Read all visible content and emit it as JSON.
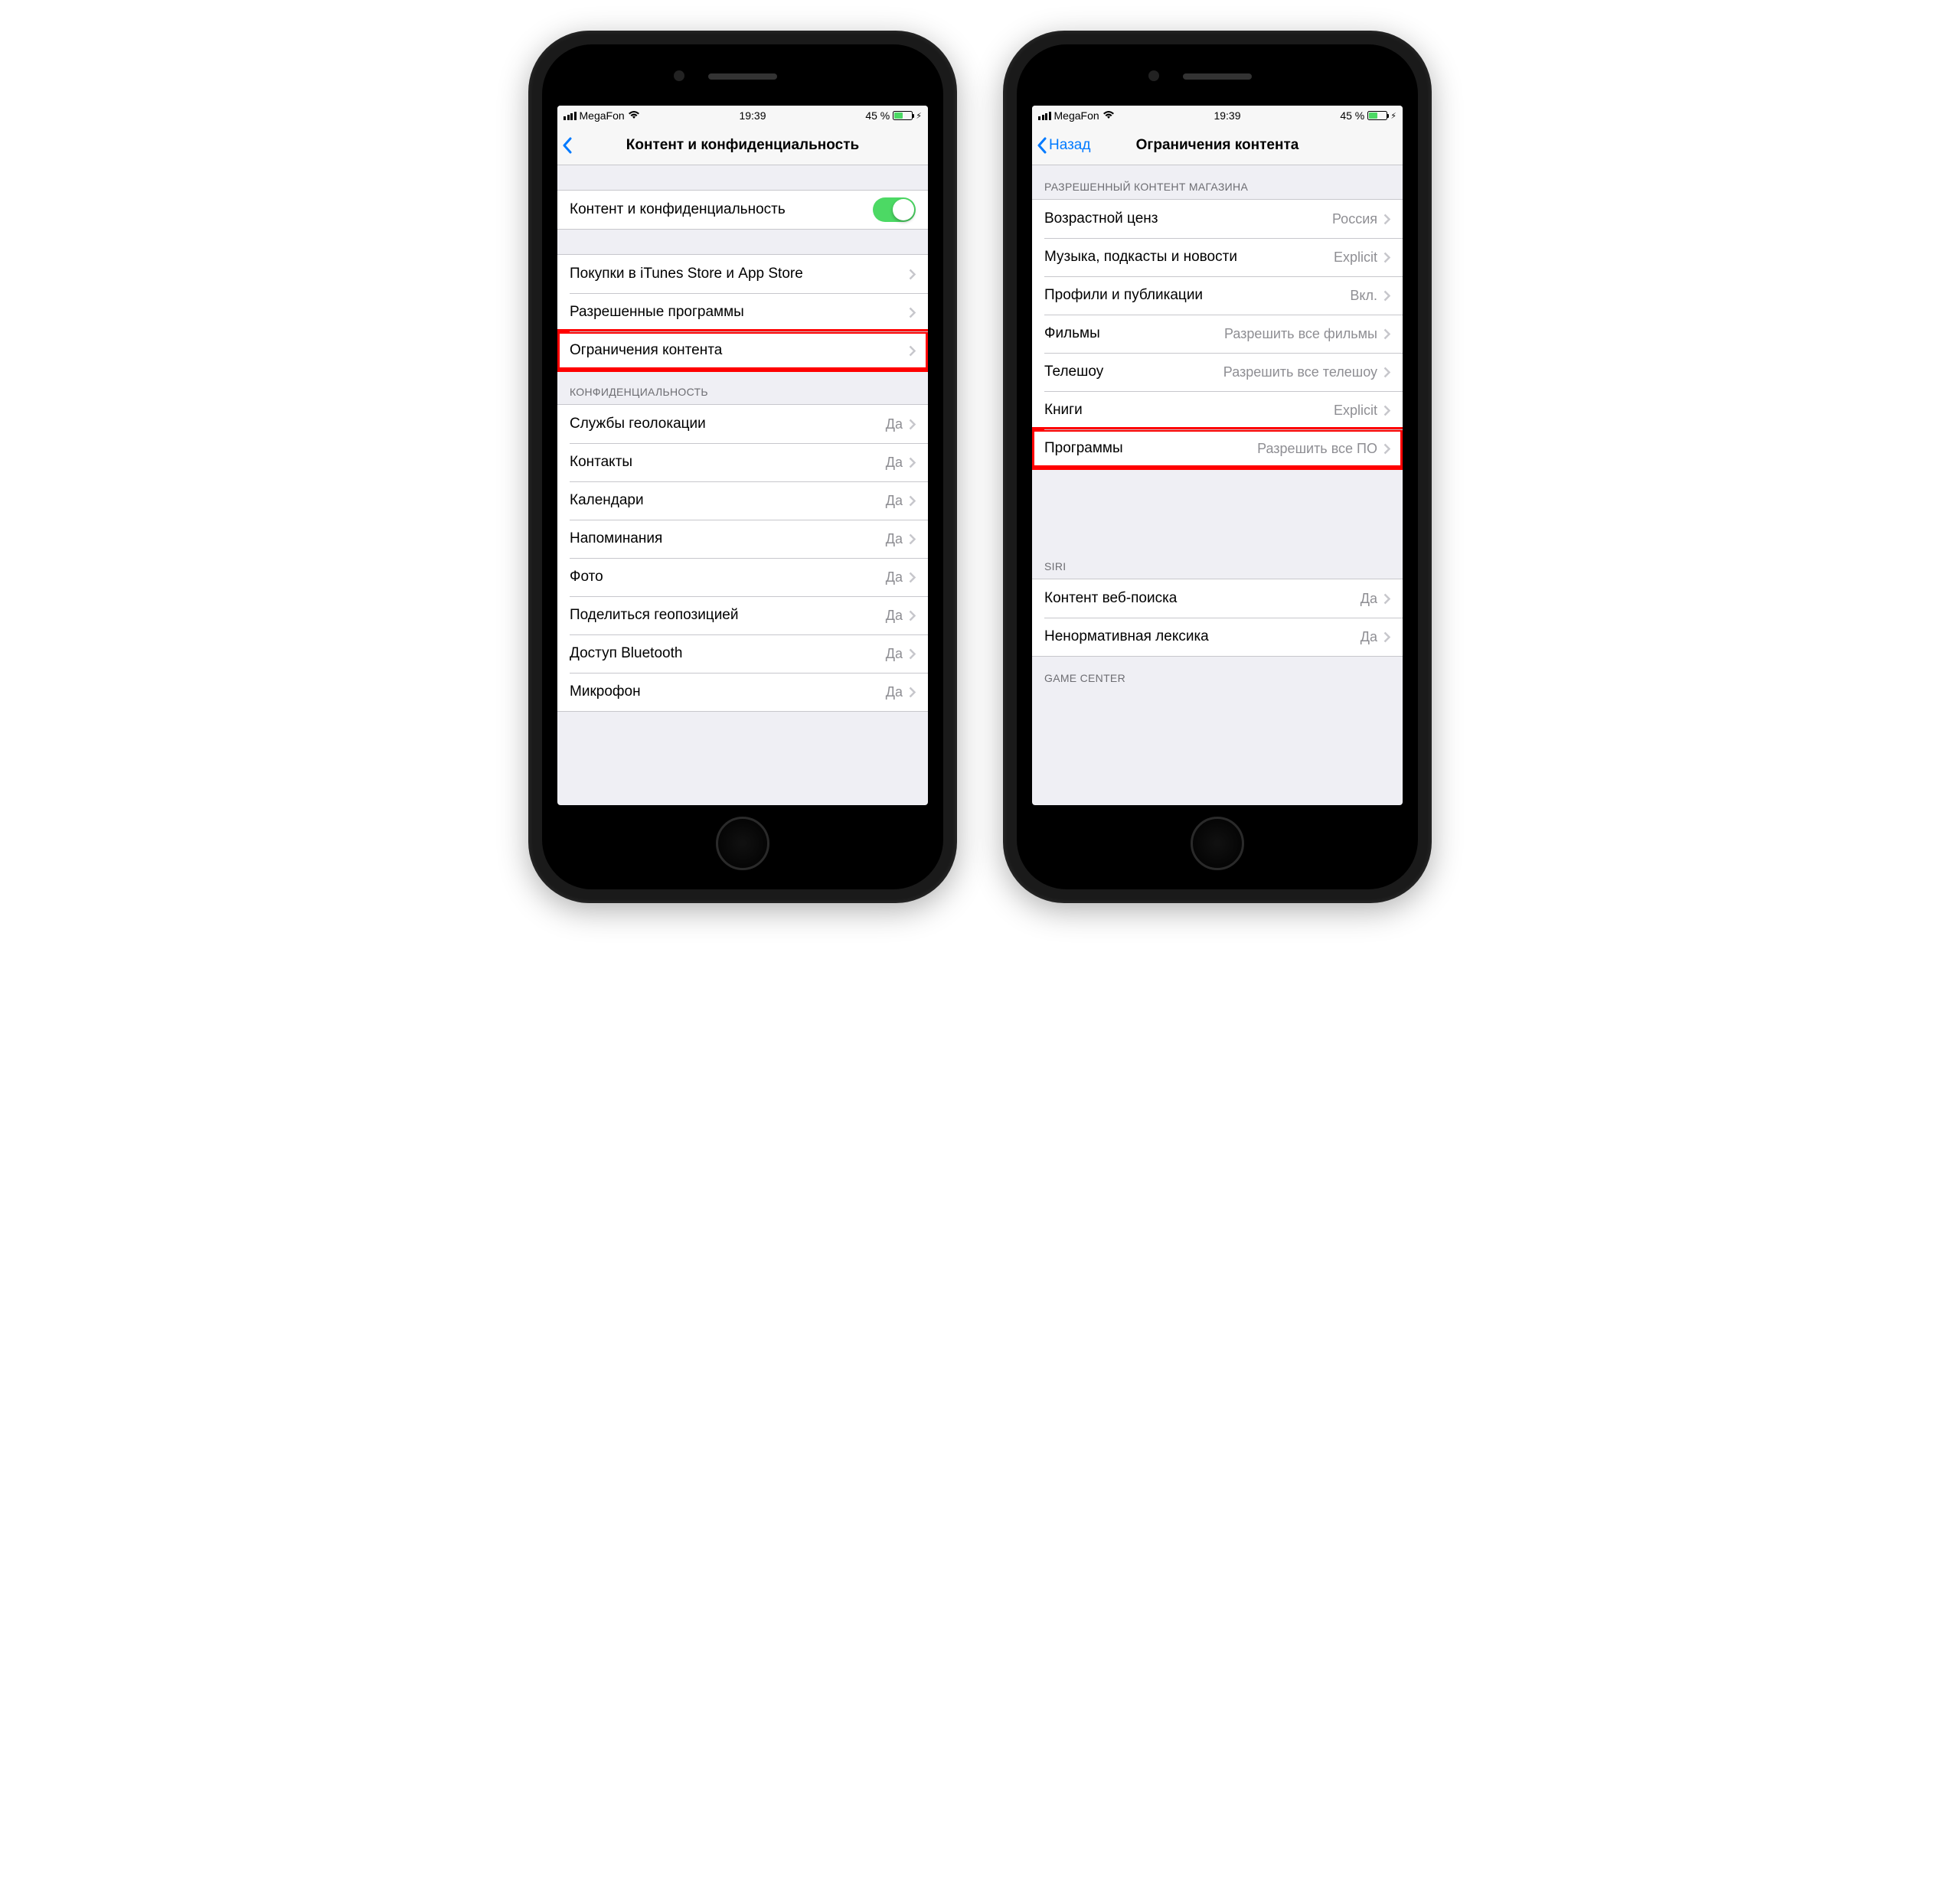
{
  "status": {
    "carrier": "MegaFon",
    "time": "19:39",
    "battery_pct": "45 %"
  },
  "left": {
    "nav_title": "Контент и конфиденциальность",
    "toggle_label": "Контент и конфиденциальность",
    "rows_main": [
      {
        "label": "Покупки в iTunes Store и App Store"
      },
      {
        "label": "Разрешенные программы"
      },
      {
        "label": "Ограничения контента",
        "highlight": true
      }
    ],
    "section_privacy": "КОНФИДЕНЦИАЛЬНОСТЬ",
    "rows_privacy": [
      {
        "label": "Службы геолокации",
        "value": "Да"
      },
      {
        "label": "Контакты",
        "value": "Да"
      },
      {
        "label": "Календари",
        "value": "Да"
      },
      {
        "label": "Напоминания",
        "value": "Да"
      },
      {
        "label": "Фото",
        "value": "Да"
      },
      {
        "label": "Поделиться геопозицией",
        "value": "Да"
      },
      {
        "label": "Доступ Bluetooth",
        "value": "Да"
      },
      {
        "label": "Микрофон",
        "value": "Да"
      }
    ]
  },
  "right": {
    "nav_back": "Назад",
    "nav_title": "Ограничения контента",
    "section_store": "РАЗРЕШЕННЫЙ КОНТЕНТ МАГАЗИНА",
    "rows_store": [
      {
        "label": "Возрастной ценз",
        "value": "Россия"
      },
      {
        "label": "Музыка, подкасты и новости",
        "value": "Explicit"
      },
      {
        "label": "Профили и публикации",
        "value": "Вкл."
      },
      {
        "label": "Фильмы",
        "value": "Разрешить все фильмы"
      },
      {
        "label": "Телешоу",
        "value": "Разрешить все телешоу"
      },
      {
        "label": "Книги",
        "value": "Explicit"
      },
      {
        "label": "Программы",
        "value": "Разрешить все ПО",
        "highlight": true
      }
    ],
    "section_siri": "SIRI",
    "rows_siri": [
      {
        "label": "Контент веб-поиска",
        "value": "Да"
      },
      {
        "label": "Ненормативная лексика",
        "value": "Да"
      }
    ],
    "section_gc": "GAME CENTER"
  }
}
